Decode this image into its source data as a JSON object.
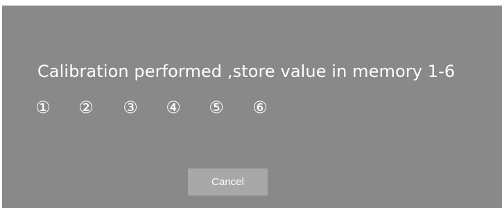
{
  "dialog": {
    "message": "Calibration performed ,store value in memory 1-6",
    "memory_slots": [
      "①",
      "②",
      "③",
      "④",
      "⑤",
      "⑥"
    ],
    "cancel_label": "Cancel",
    "colors": {
      "background": "#898989",
      "text": "#ffffff",
      "button": "#a8a8a8"
    }
  }
}
